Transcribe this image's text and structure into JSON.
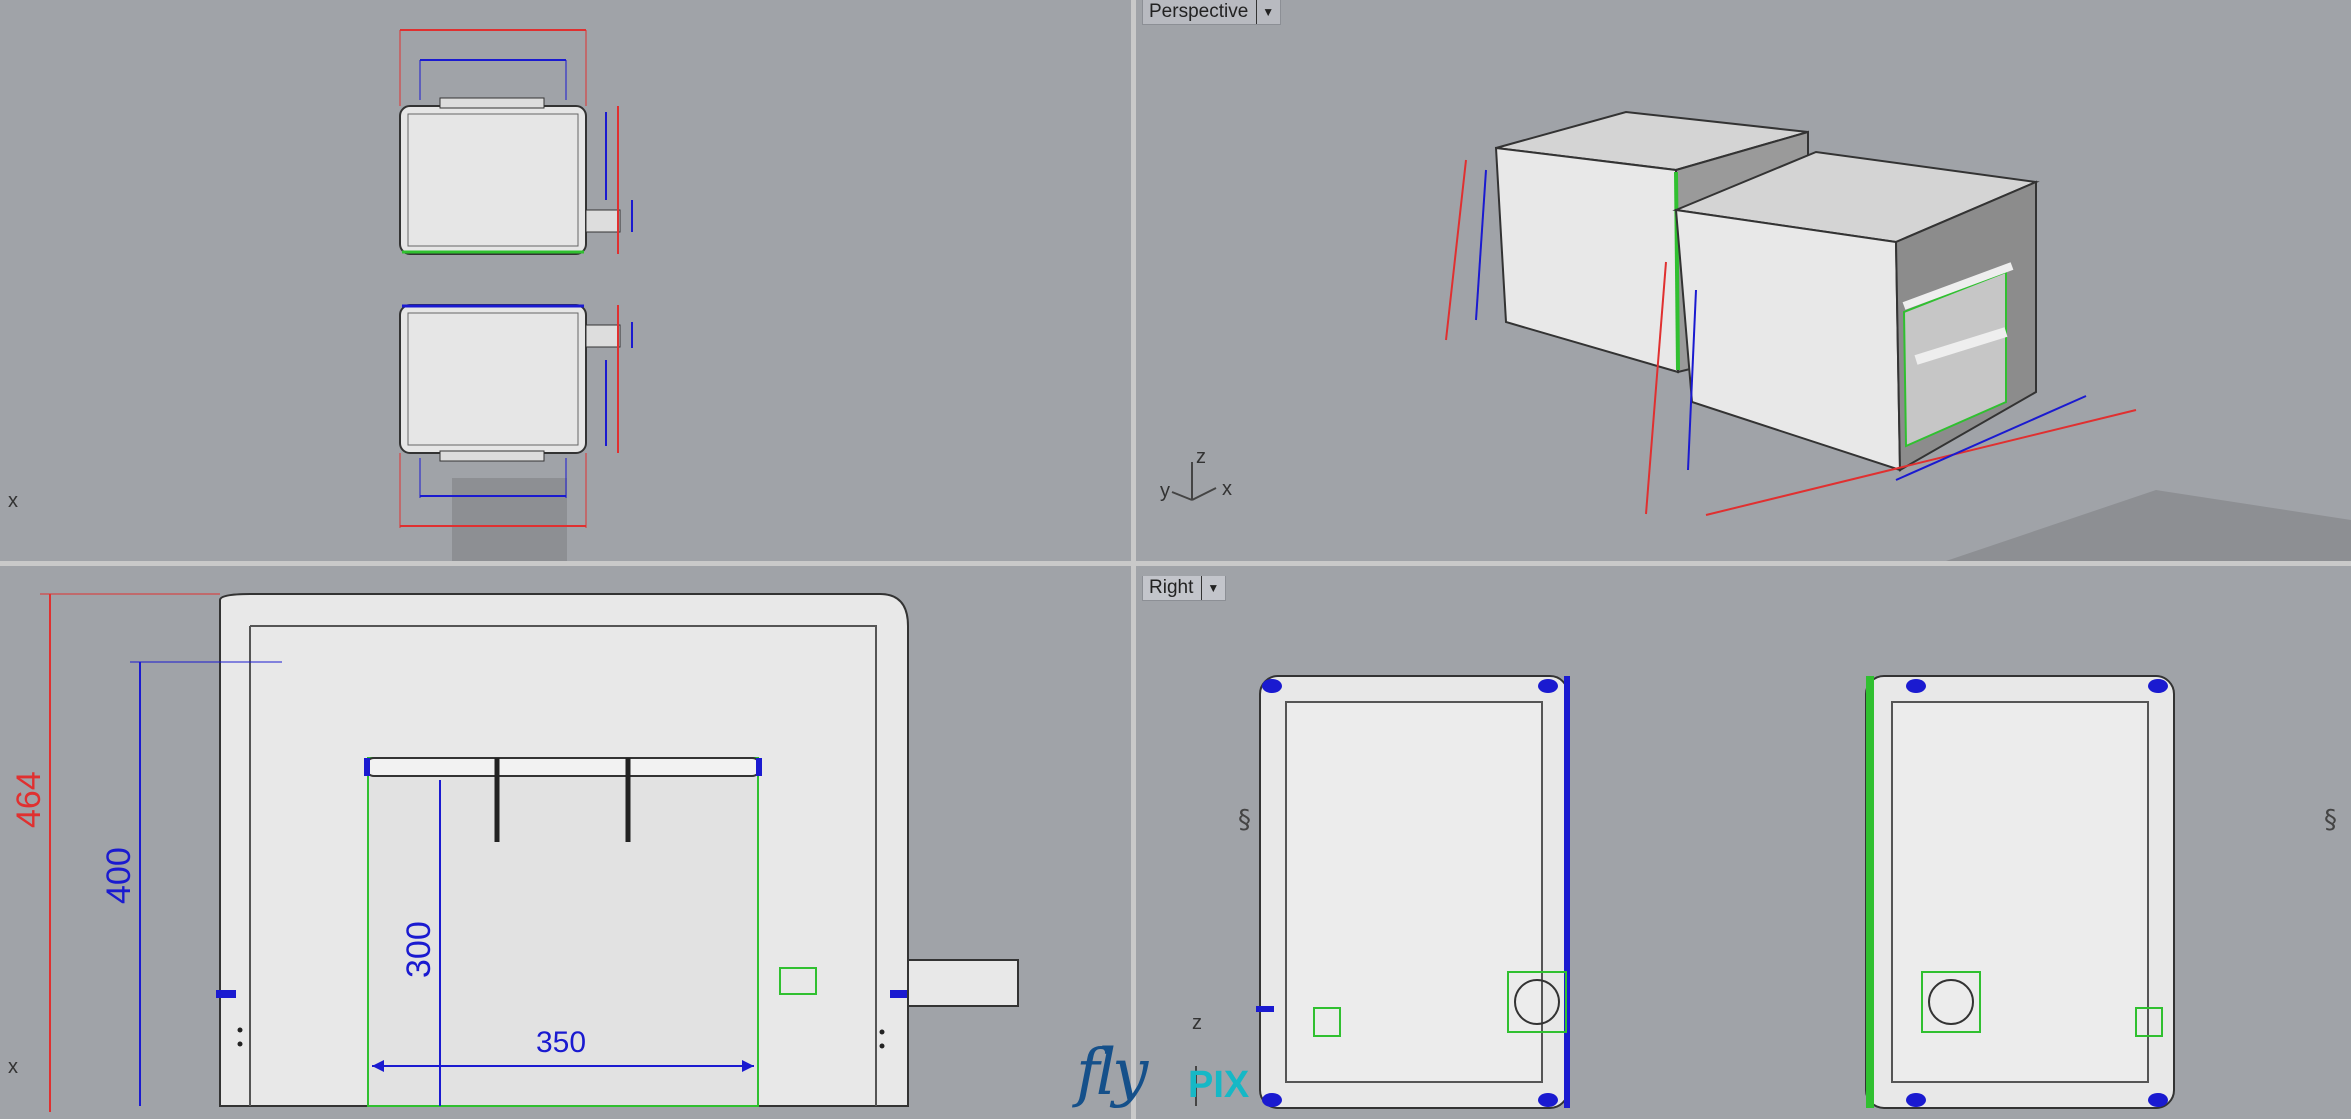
{
  "viewports": {
    "top": {
      "x_label": "x"
    },
    "perspective": {
      "label": "Perspective",
      "axes": {
        "z": "z",
        "y": "y",
        "x": "x"
      }
    },
    "front": {
      "x_label": "x",
      "dims": {
        "total_height": "464",
        "inner_height": "400",
        "door_height": "300",
        "door_width": "350"
      }
    },
    "right": {
      "label": "Right",
      "axes": {
        "z": "z"
      }
    }
  },
  "logo": {
    "fly": "fly",
    "pix": "PIX"
  },
  "colors": {
    "viewport_bg": "#a0a3a8",
    "dim_red": "#e03030",
    "dim_blue": "#1a1ad0",
    "edge_green": "#30c030",
    "logo_blue": "#15508a",
    "logo_cyan": "#16b8c6"
  }
}
